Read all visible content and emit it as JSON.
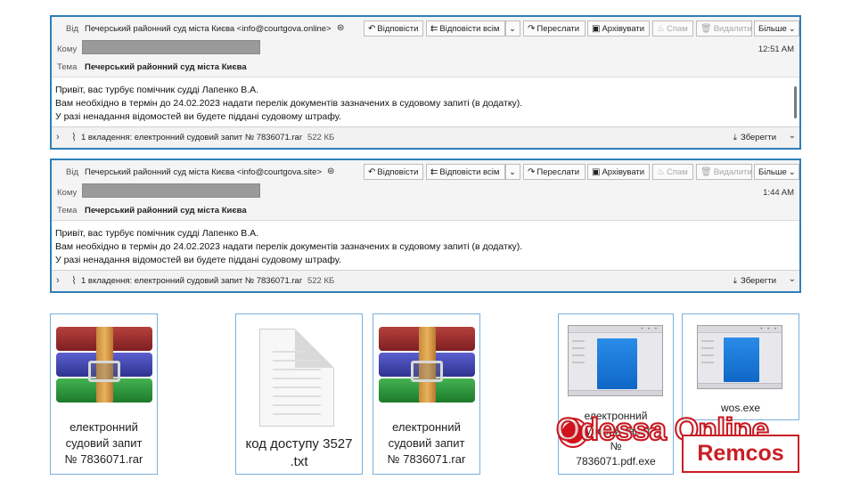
{
  "emails": [
    {
      "from_label": "Від",
      "from": "Печерський районний суд міста Києва <info@courtgova.online>",
      "to_label": "Кому",
      "subject_label": "Тема",
      "subject": "Печерський районний суд міста Києва",
      "time": "12:51 AM",
      "body": [
        "Привіт, вас турбує помічник судді Лапенко В.А.",
        "Вам необхідно в термін до 24.02.2023 надати перелік документів зазначених в судовому запиті (в додатку).",
        "У разі ненадання відомостей ви будете піддані судовому штрафу."
      ],
      "attachment_text": "1 вкладення: електронний судовий запит № 7836071.rar",
      "attachment_size": "522 КБ"
    },
    {
      "from_label": "Від",
      "from": "Печерський районний суд міста Києва <info@courtgova.site>",
      "to_label": "Кому",
      "subject_label": "Тема",
      "subject": "Печерський районний суд міста Києва",
      "time": "1:44 AM",
      "body": [
        "Привіт, вас турбує помічник судді Лапенко В.А.",
        "Вам необхідно в термін до 24.02.2023 надати перелік документів зазначених в судовому запиті (в додатку).",
        "У разі ненадання відомостей ви будете піддані судовому штрафу."
      ],
      "attachment_text": "1 вкладення: електронний судовий запит № 7836071.rar",
      "attachment_size": "522 КБ"
    }
  ],
  "toolbar": {
    "reply": "Відповісти",
    "reply_all": "Відповісти всім",
    "forward": "Переслати",
    "archive": "Архівувати",
    "spam": "Спам",
    "delete": "Видалити",
    "more": "Більше"
  },
  "save_label": "Зберегти",
  "icons": {
    "reply": "reply-icon",
    "reply_all": "reply-all-icon",
    "forward": "forward-icon",
    "archive": "archive-icon",
    "spam": "spam-icon",
    "delete": "trash-icon",
    "save": "download-icon",
    "attachment": "paperclip-icon"
  },
  "files": [
    {
      "icon": "winrar-archive-icon",
      "label_lines": [
        "електронний",
        "судовий запит",
        "№ 7836071.rar"
      ]
    },
    {
      "icon": "text-document-icon",
      "label_lines": [
        "код доступу 3527",
        ".txt"
      ]
    },
    {
      "icon": "winrar-archive-icon",
      "label_lines": [
        "електронний",
        "судовий запит",
        "№ 7836071.rar"
      ]
    },
    {
      "icon": "executable-window-icon",
      "label_lines": [
        "електронний",
        "судовий запит",
        "№",
        "7836071.pdf.exe"
      ]
    },
    {
      "icon": "executable-window-icon",
      "label_lines": [
        "wos.exe"
      ]
    }
  ],
  "watermark": "Odessa Online",
  "malware_label": "Remcos",
  "colors": {
    "window_border": "#2d7fb8",
    "file_border": "#7ab0dc",
    "remcos_red": "#c81e24",
    "watermark_red": "#d3121b"
  }
}
